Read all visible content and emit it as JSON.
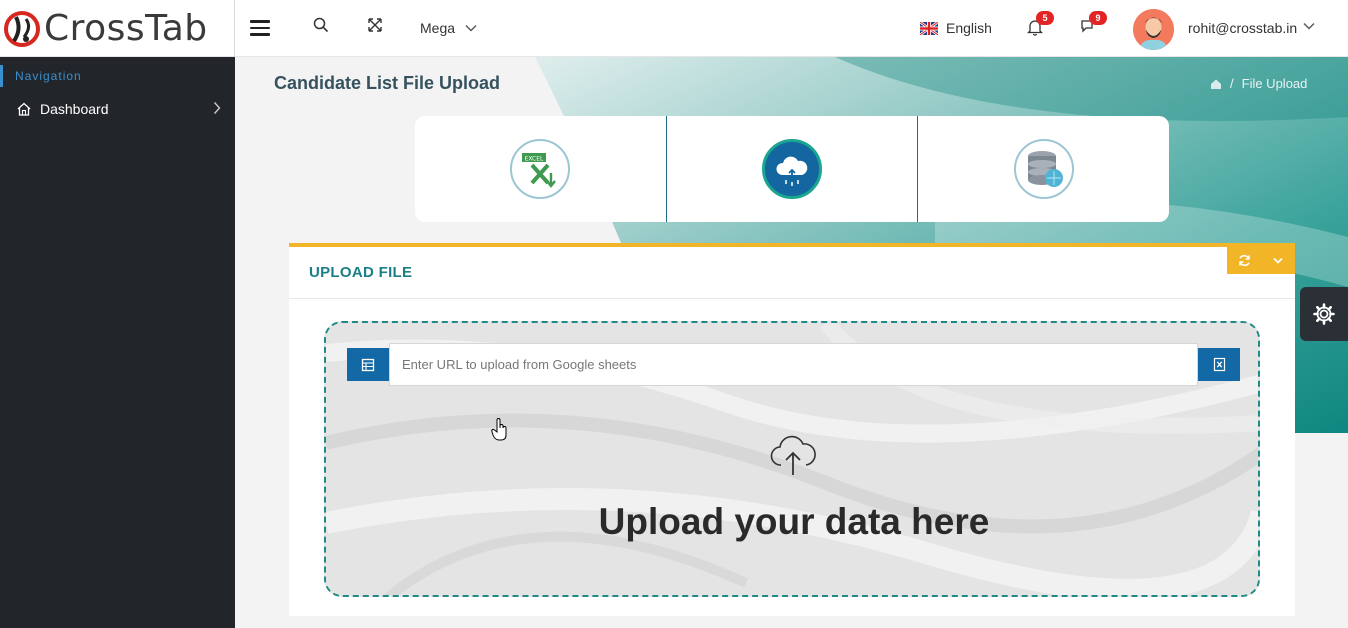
{
  "app": {
    "brand": "CrossTab"
  },
  "header": {
    "mega_label": "Mega",
    "language": "English",
    "notifications_count": "5",
    "messages_count": "9",
    "user_email": "rohit@crosstab.in"
  },
  "sidebar": {
    "heading": "Navigation",
    "items": [
      {
        "label": "Dashboard"
      }
    ]
  },
  "page": {
    "title": "Candidate List File Upload",
    "breadcrumb": {
      "current": "File Upload"
    }
  },
  "steps": [
    {
      "icon": "excel-icon"
    },
    {
      "icon": "cloud-upload-icon"
    },
    {
      "icon": "database-icon"
    }
  ],
  "upload": {
    "card_title": "UPLOAD FILE",
    "url_placeholder": "Enter URL to upload from Google sheets",
    "drop_text": "Upload your data here"
  },
  "colors": {
    "sidebar_bg": "#222529",
    "accent_blue": "#1369a6",
    "card_top_border": "#f2b527",
    "teal": "#1e8b86"
  }
}
